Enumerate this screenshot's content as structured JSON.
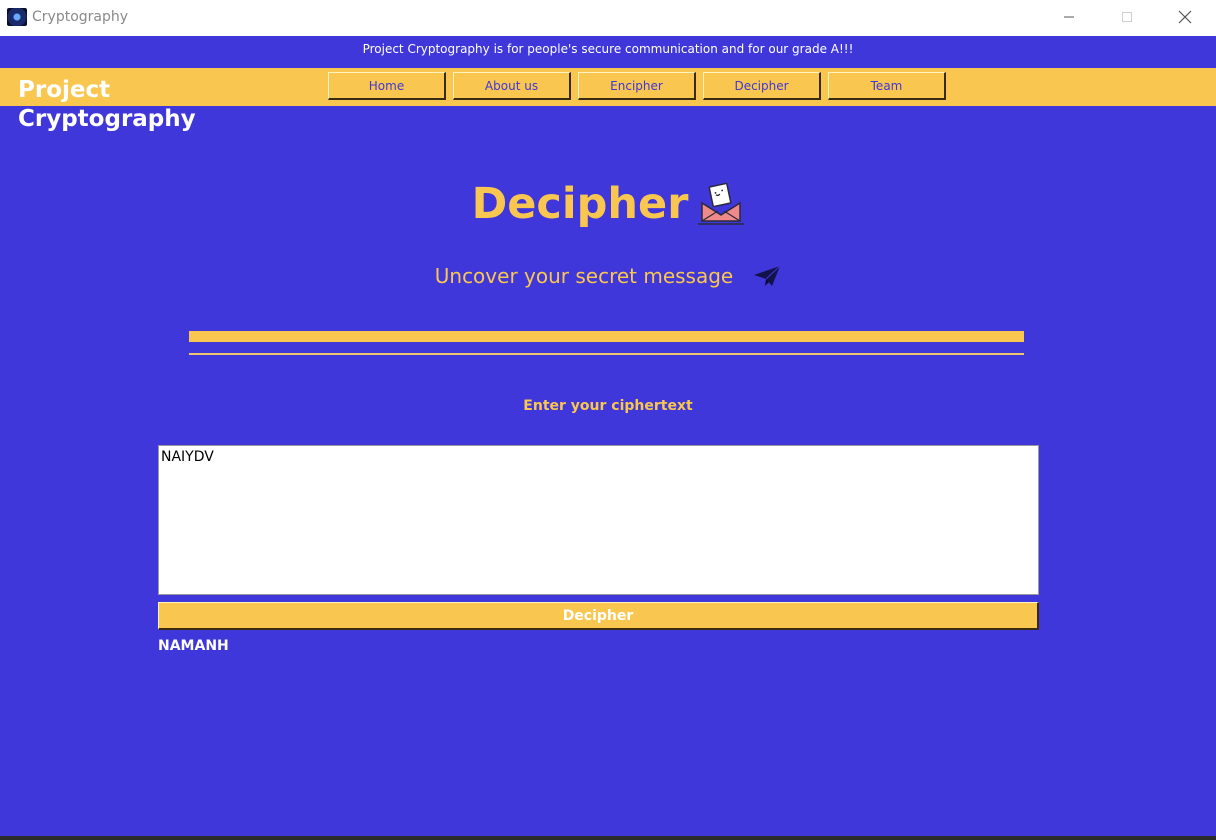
{
  "window": {
    "title": "Cryptography"
  },
  "tagline": "Project Cryptography is for people's secure communication and for our grade A!!!",
  "brand": "Project Cryptography",
  "nav": {
    "items": [
      {
        "label": "Home"
      },
      {
        "label": "About us"
      },
      {
        "label": "Encipher"
      },
      {
        "label": "Decipher"
      },
      {
        "label": "Team"
      }
    ]
  },
  "page": {
    "heading": "Decipher",
    "subheading": "Uncover your secret message",
    "prompt": "Enter your ciphertext",
    "ciphertext_value": "NAIYDV",
    "decipher_button_label": "Decipher",
    "result": "NAMANH"
  },
  "icons": {
    "heading": "envelope-letter-icon",
    "subheading": "paper-plane-icon"
  },
  "colors": {
    "background": "#3f37d9",
    "accent": "#f9c74f",
    "text_light": "#ffffff"
  }
}
